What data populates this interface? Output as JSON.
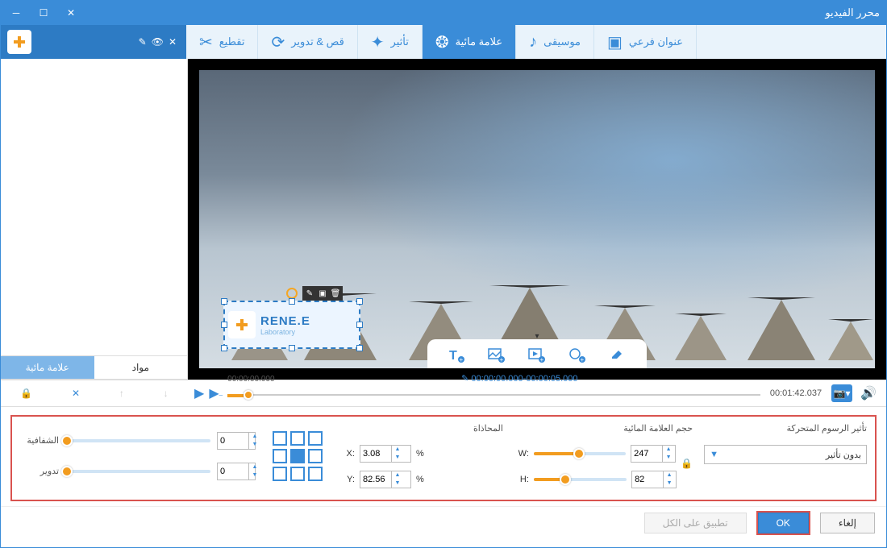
{
  "window": {
    "title": "محرر الفيديو"
  },
  "brand": {
    "name": "RENE.E",
    "sub": "Laboratory"
  },
  "tabs": [
    {
      "id": "cut",
      "label": "تقطيع"
    },
    {
      "id": "crop",
      "label": "قص & تدوير"
    },
    {
      "id": "effect",
      "label": "تأثير"
    },
    {
      "id": "watermark",
      "label": "علامة مائية"
    },
    {
      "id": "music",
      "label": "موسيقى"
    },
    {
      "id": "subtitle",
      "label": "عنوان فرعي"
    }
  ],
  "sidebar_tabs": {
    "watermark": "علامة مائية",
    "materials": "مواد"
  },
  "timeline": {
    "current": "00:00:00.000",
    "range": "00:00:00.000-00:00:05.000",
    "total": "00:01:42.037"
  },
  "settings": {
    "anim_title": "تأثير الرسوم المتحركة",
    "anim_value": "بدون تأثير",
    "size_title": "حجم العلامة المائية",
    "w_label": "W:",
    "h_label": "H:",
    "w_value": "247",
    "h_value": "82",
    "align_title": "المحاذاة",
    "x_label": "X:",
    "y_label": "Y:",
    "x_value": "3.08",
    "y_value": "82.56",
    "percent": "%",
    "opacity_label": "الشفافية",
    "rotate_label": "تدوير",
    "opacity_value": "0",
    "rotate_value": "0"
  },
  "footer": {
    "ok": "OK",
    "cancel": "إلغاء",
    "apply_all": "تطبيق على الكل"
  }
}
